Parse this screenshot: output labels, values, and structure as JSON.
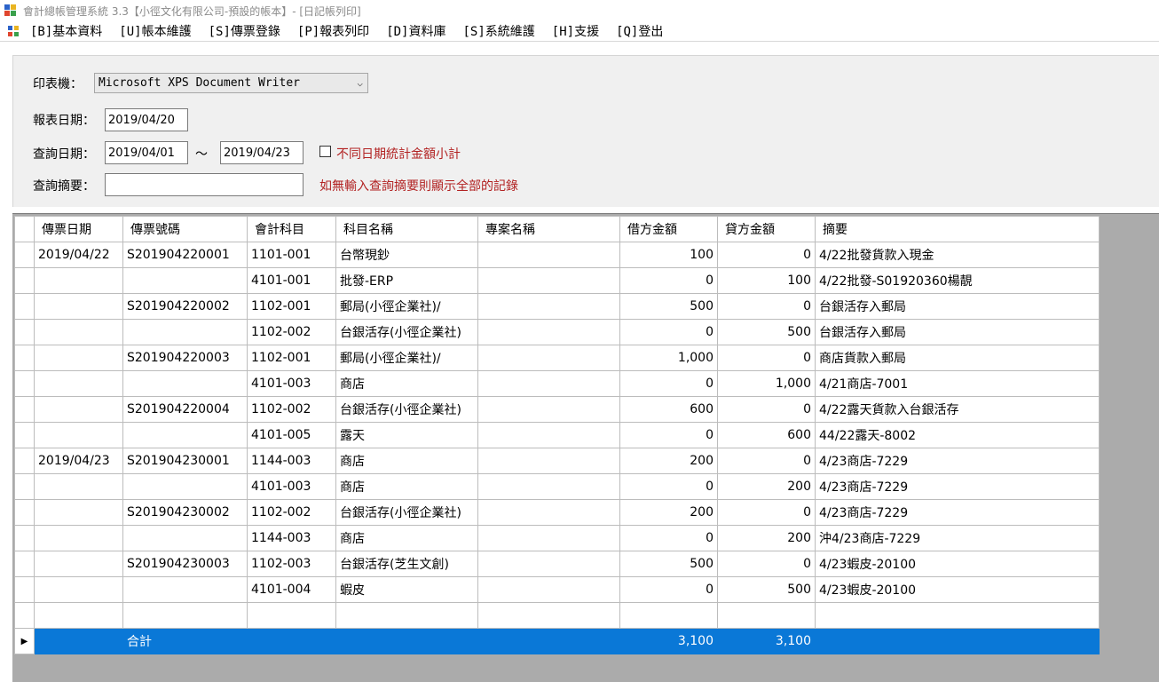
{
  "window": {
    "title": "會計總帳管理系統 3.3【小徑文化有限公司-預設的帳本】- [日記帳列印]"
  },
  "menu": [
    "[B]基本資料",
    "[U]帳本維護",
    "[S]傳票登錄",
    "[P]報表列印",
    "[D]資料庫",
    "[S]系統維護",
    "[H]支援",
    "[Q]登出"
  ],
  "form": {
    "printer_label": "印表機：",
    "printer_value": "Microsoft XPS Document Writer",
    "report_date_label": "報表日期：",
    "report_date": "2019/04/20",
    "query_date_label": "查詢日期：",
    "query_date_from": "2019/04/01",
    "range_sep": "～",
    "query_date_to": "2019/04/23",
    "subtotal_checkbox_label": "不同日期統計金額小計",
    "summary_label": "查詢摘要：",
    "summary_value": "",
    "summary_hint": "如無輸入查詢摘要則顯示全部的記錄"
  },
  "grid": {
    "columns": [
      "傳票日期",
      "傳票號碼",
      "會計科目",
      "科目名稱",
      "專案名稱",
      "借方金額",
      "貸方金額",
      "摘要"
    ],
    "rows": [
      [
        "2019/04/22",
        "S201904220001",
        "1101-001",
        "台幣現鈔",
        "",
        "100",
        "0",
        "4/22批發貨款入現金"
      ],
      [
        "",
        "",
        "4101-001",
        "批發-ERP",
        "",
        "0",
        "100",
        "4/22批發-S01920360楊靚"
      ],
      [
        "",
        "S201904220002",
        "1102-001",
        "郵局(小徑企業社)/",
        "",
        "500",
        "0",
        "台銀活存入郵局"
      ],
      [
        "",
        "",
        "1102-002",
        "台銀活存(小徑企業社)",
        "",
        "0",
        "500",
        "台銀活存入郵局"
      ],
      [
        "",
        "S201904220003",
        "1102-001",
        "郵局(小徑企業社)/",
        "",
        "1,000",
        "0",
        "商店貨款入郵局"
      ],
      [
        "",
        "",
        "4101-003",
        "商店",
        "",
        "0",
        "1,000",
        "4/21商店-7001"
      ],
      [
        "",
        "S201904220004",
        "1102-002",
        "台銀活存(小徑企業社)",
        "",
        "600",
        "0",
        "4/22露天貨款入台銀活存"
      ],
      [
        "",
        "",
        "4101-005",
        "露天",
        "",
        "0",
        "600",
        "44/22露天-8002"
      ],
      [
        "2019/04/23",
        "S201904230001",
        "1144-003",
        "商店",
        "",
        "200",
        "0",
        "4/23商店-7229"
      ],
      [
        "",
        "",
        "4101-003",
        "商店",
        "",
        "0",
        "200",
        "4/23商店-7229"
      ],
      [
        "",
        "S201904230002",
        "1102-002",
        "台銀活存(小徑企業社)",
        "",
        "200",
        "0",
        "4/23商店-7229"
      ],
      [
        "",
        "",
        "1144-003",
        "商店",
        "",
        "0",
        "200",
        "沖4/23商店-7229"
      ],
      [
        "",
        "S201904230003",
        "1102-003",
        "台銀活存(芝生文創)",
        "",
        "500",
        "0",
        "4/23蝦皮-20100"
      ],
      [
        "",
        "",
        "4101-004",
        "蝦皮",
        "",
        "0",
        "500",
        "4/23蝦皮-20100"
      ],
      [
        "",
        "",
        "",
        "",
        "",
        "",
        "",
        ""
      ]
    ],
    "total": [
      "",
      "合計",
      "",
      "",
      "",
      "3,100",
      "3,100",
      ""
    ],
    "current_row_marker": "▶"
  }
}
